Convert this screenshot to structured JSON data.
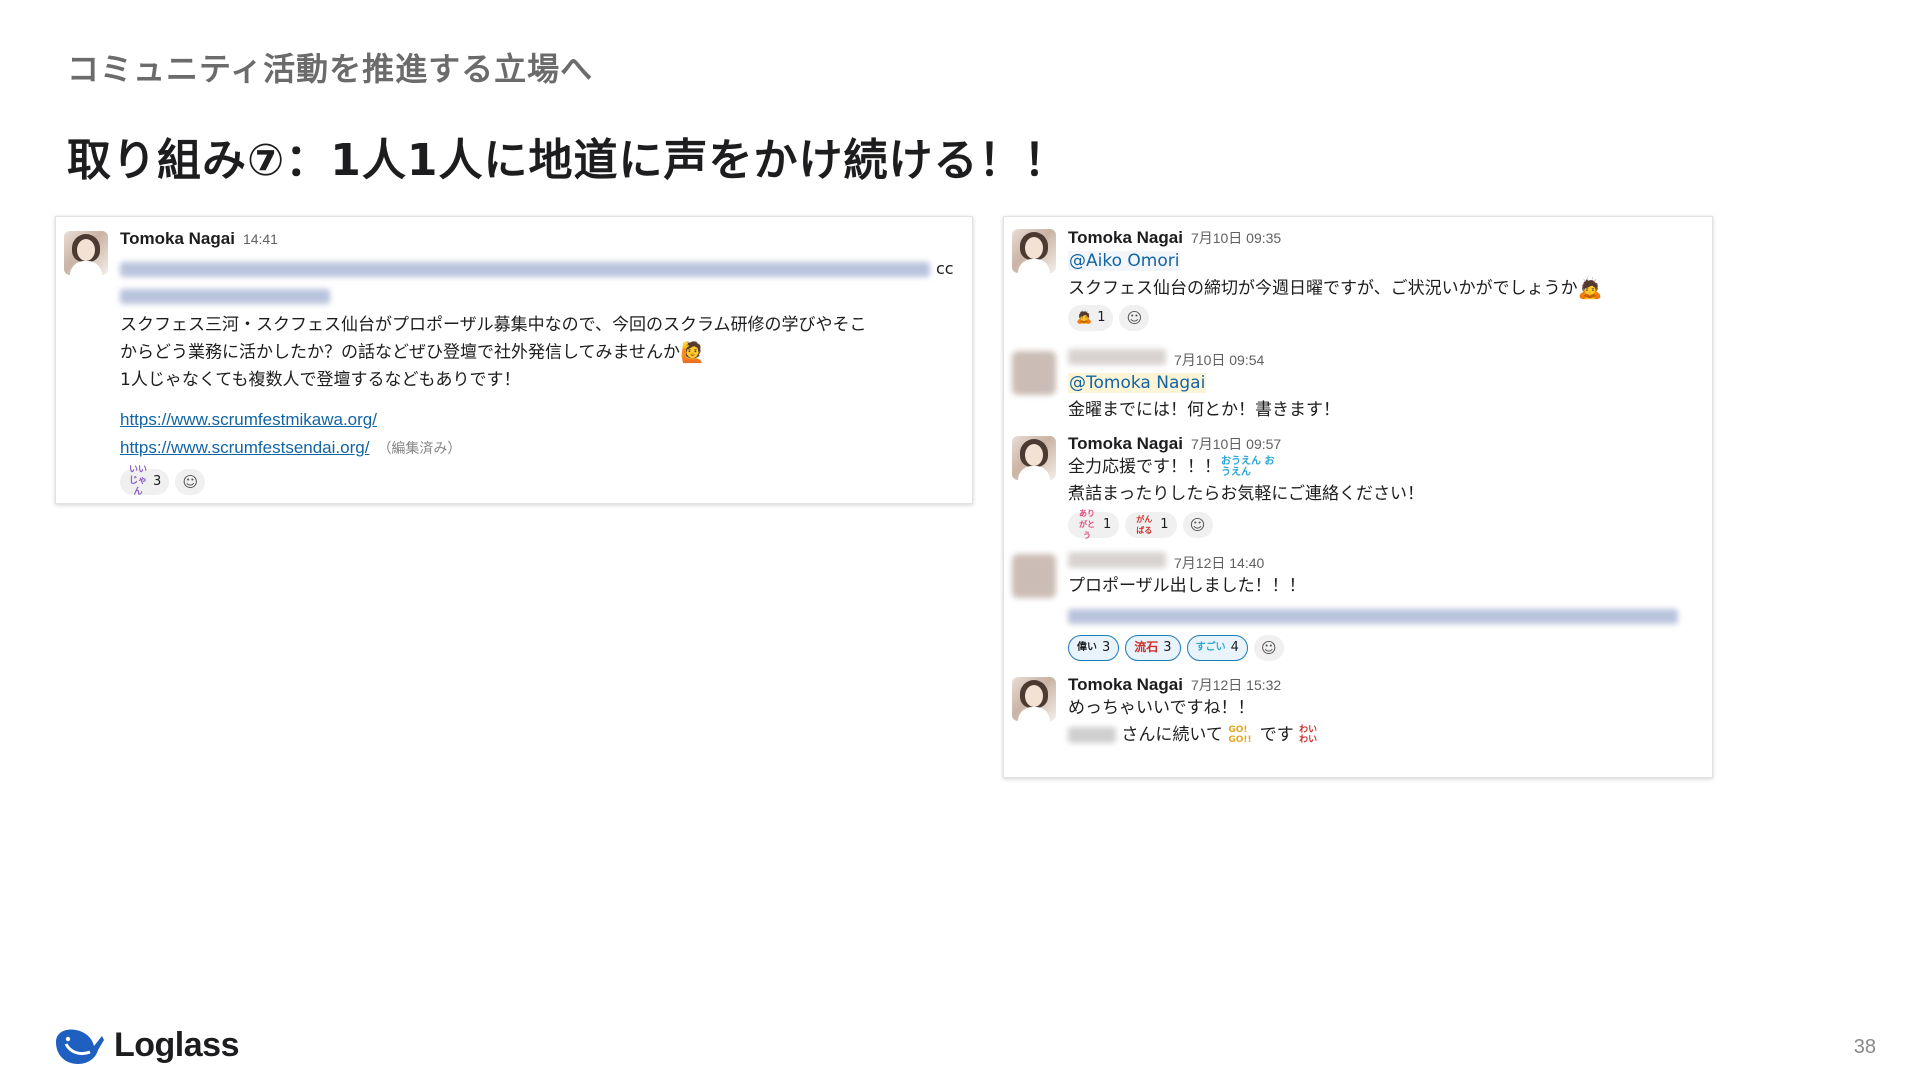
{
  "section_title": "コミュニティ活動を推進する立場へ",
  "slide_title": "取り組み⑦：1人1人に地道に声をかけ続ける！！",
  "left_card": {
    "author": "Tomoka Nagai",
    "time": "14:41",
    "cc": "cc",
    "body": [
      "スクフェス三河・スクフェス仙台がプロポーザル募集中なので、今回のスクラム研修の学びやそこ",
      "からどう業務に活かしたか？の話などぜひ登壇で社外発信してみませんか",
      "1人じゃなくても複数人で登壇するなどもありです！"
    ],
    "links": [
      "https://www.scrumfestmikawa.org/",
      "https://www.scrumfestsendai.org/"
    ],
    "edited": "（編集済み）",
    "reaction": {
      "emoji": "いい じゃん",
      "count": "3"
    }
  },
  "right_card": {
    "messages": [
      {
        "author": "Tomoka Nagai",
        "time": "7月10日 09:35",
        "mention": "@Aiko Omori",
        "text": "スクフェス仙台の締切が今週日曜ですが、ご状況いかがでしょうか",
        "reactions": [
          {
            "emoji": "🙇",
            "count": "1"
          }
        ]
      },
      {
        "time": "7月10日 09:54",
        "mention": "@Tomoka Nagai",
        "text": "金曜までには！何とか！書きます！"
      },
      {
        "author": "Tomoka Nagai",
        "time": "7月10日 09:57",
        "lines": [
          "全力応援です！！！",
          "煮詰まったりしたらお気軽にご連絡ください！"
        ],
        "inline_emoji": "おうえん おうえん",
        "reactions": [
          {
            "emoji": "ありがとう",
            "count": "1"
          },
          {
            "emoji": "がんばる",
            "count": "1"
          }
        ]
      },
      {
        "time": "7月12日 14:40",
        "text": "プロポーザル出しました！！！",
        "reactions": [
          {
            "emoji": "偉い",
            "count": "3"
          },
          {
            "emoji": "流石",
            "count": "3"
          },
          {
            "emoji": "すごい",
            "count": "4"
          }
        ]
      },
      {
        "author": "Tomoka Nagai",
        "time": "7月12日 15:32",
        "line1": "めっちゃいいですね！！",
        "line2_mid": "さんに続いて",
        "emoji_go": "GO! GO!!",
        "line2_end": "です",
        "emoji_wai": "わい わい"
      }
    ]
  },
  "footer": {
    "logo_text": "Loglass",
    "page_number": "38"
  },
  "colors": {
    "link": "#1264a3",
    "brand_blue": "#1f5fbf"
  }
}
